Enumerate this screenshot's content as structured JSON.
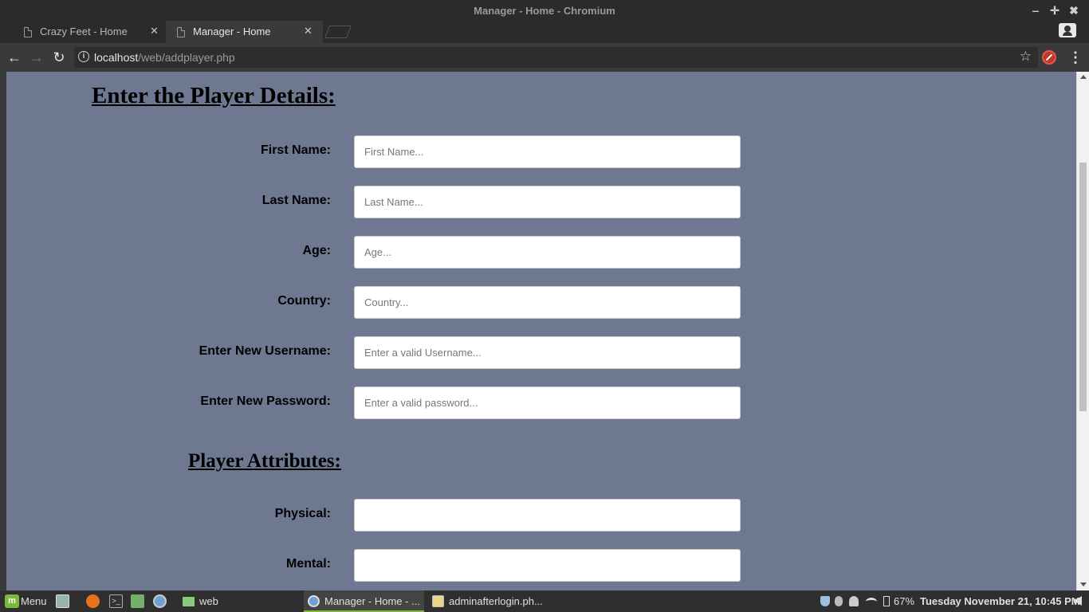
{
  "window": {
    "title": "Manager - Home - Chromium",
    "controls": {
      "minimize": "‒",
      "maximize": "✛",
      "close": "✖"
    }
  },
  "tabs": [
    {
      "label": "Crazy Feet - Home",
      "active": false,
      "close": "✕"
    },
    {
      "label": "Manager - Home",
      "active": true,
      "close": "✕"
    }
  ],
  "toolbar": {
    "back": "←",
    "forward": "→",
    "reload": "↻",
    "url_host": "localhost",
    "url_path": "/web/addplayer.php",
    "info_icon": "i",
    "star": "☆",
    "menu": "⋮"
  },
  "page": {
    "heading": "Enter the Player Details:",
    "fields": [
      {
        "label": "First Name:",
        "placeholder": "First Name...",
        "value": ""
      },
      {
        "label": "Last Name:",
        "placeholder": "Last Name...",
        "value": ""
      },
      {
        "label": "Age:",
        "placeholder": "Age...",
        "value": ""
      },
      {
        "label": "Country:",
        "placeholder": "Country...",
        "value": ""
      },
      {
        "label": "Enter New Username:",
        "placeholder": "Enter a valid Username...",
        "value": ""
      },
      {
        "label": "Enter New Password:",
        "placeholder": "Enter a valid password...",
        "value": ""
      }
    ],
    "attributes_heading": "Player Attributes:",
    "attributes": [
      {
        "label": "Physical:",
        "placeholder": "",
        "value": ""
      },
      {
        "label": "Mental:",
        "placeholder": "",
        "value": ""
      }
    ]
  },
  "taskbar": {
    "menu_label": "Menu",
    "mint_logo": "m",
    "folder_label": "web",
    "terminal_glyph": ">_",
    "tasks": [
      {
        "label": "Manager - Home - ...",
        "active": true
      },
      {
        "label": "adminafterlogin.ph...",
        "active": false
      }
    ],
    "battery": "67%",
    "clock": "Tuesday November 21, 10:45 PM"
  }
}
